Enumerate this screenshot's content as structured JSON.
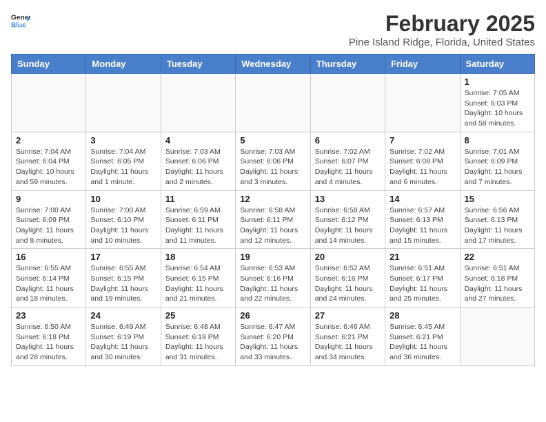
{
  "logo": {
    "general": "General",
    "blue": "Blue"
  },
  "header": {
    "title": "February 2025",
    "subtitle": "Pine Island Ridge, Florida, United States"
  },
  "weekdays": [
    "Sunday",
    "Monday",
    "Tuesday",
    "Wednesday",
    "Thursday",
    "Friday",
    "Saturday"
  ],
  "weeks": [
    [
      {
        "day": "",
        "info": ""
      },
      {
        "day": "",
        "info": ""
      },
      {
        "day": "",
        "info": ""
      },
      {
        "day": "",
        "info": ""
      },
      {
        "day": "",
        "info": ""
      },
      {
        "day": "",
        "info": ""
      },
      {
        "day": "1",
        "info": "Sunrise: 7:05 AM\nSunset: 6:03 PM\nDaylight: 10 hours and 58 minutes."
      }
    ],
    [
      {
        "day": "2",
        "info": "Sunrise: 7:04 AM\nSunset: 6:04 PM\nDaylight: 10 hours and 59 minutes."
      },
      {
        "day": "3",
        "info": "Sunrise: 7:04 AM\nSunset: 6:05 PM\nDaylight: 11 hours and 1 minute."
      },
      {
        "day": "4",
        "info": "Sunrise: 7:03 AM\nSunset: 6:06 PM\nDaylight: 11 hours and 2 minutes."
      },
      {
        "day": "5",
        "info": "Sunrise: 7:03 AM\nSunset: 6:06 PM\nDaylight: 11 hours and 3 minutes."
      },
      {
        "day": "6",
        "info": "Sunrise: 7:02 AM\nSunset: 6:07 PM\nDaylight: 11 hours and 4 minutes."
      },
      {
        "day": "7",
        "info": "Sunrise: 7:02 AM\nSunset: 6:08 PM\nDaylight: 11 hours and 6 minutes."
      },
      {
        "day": "8",
        "info": "Sunrise: 7:01 AM\nSunset: 6:09 PM\nDaylight: 11 hours and 7 minutes."
      }
    ],
    [
      {
        "day": "9",
        "info": "Sunrise: 7:00 AM\nSunset: 6:09 PM\nDaylight: 11 hours and 8 minutes."
      },
      {
        "day": "10",
        "info": "Sunrise: 7:00 AM\nSunset: 6:10 PM\nDaylight: 11 hours and 10 minutes."
      },
      {
        "day": "11",
        "info": "Sunrise: 6:59 AM\nSunset: 6:11 PM\nDaylight: 11 hours and 11 minutes."
      },
      {
        "day": "12",
        "info": "Sunrise: 6:58 AM\nSunset: 6:11 PM\nDaylight: 11 hours and 12 minutes."
      },
      {
        "day": "13",
        "info": "Sunrise: 6:58 AM\nSunset: 6:12 PM\nDaylight: 11 hours and 14 minutes."
      },
      {
        "day": "14",
        "info": "Sunrise: 6:57 AM\nSunset: 6:13 PM\nDaylight: 11 hours and 15 minutes."
      },
      {
        "day": "15",
        "info": "Sunrise: 6:56 AM\nSunset: 6:13 PM\nDaylight: 11 hours and 17 minutes."
      }
    ],
    [
      {
        "day": "16",
        "info": "Sunrise: 6:55 AM\nSunset: 6:14 PM\nDaylight: 11 hours and 18 minutes."
      },
      {
        "day": "17",
        "info": "Sunrise: 6:55 AM\nSunset: 6:15 PM\nDaylight: 11 hours and 19 minutes."
      },
      {
        "day": "18",
        "info": "Sunrise: 6:54 AM\nSunset: 6:15 PM\nDaylight: 11 hours and 21 minutes."
      },
      {
        "day": "19",
        "info": "Sunrise: 6:53 AM\nSunset: 6:16 PM\nDaylight: 11 hours and 22 minutes."
      },
      {
        "day": "20",
        "info": "Sunrise: 6:52 AM\nSunset: 6:16 PM\nDaylight: 11 hours and 24 minutes."
      },
      {
        "day": "21",
        "info": "Sunrise: 6:51 AM\nSunset: 6:17 PM\nDaylight: 11 hours and 25 minutes."
      },
      {
        "day": "22",
        "info": "Sunrise: 6:51 AM\nSunset: 6:18 PM\nDaylight: 11 hours and 27 minutes."
      }
    ],
    [
      {
        "day": "23",
        "info": "Sunrise: 6:50 AM\nSunset: 6:18 PM\nDaylight: 11 hours and 28 minutes."
      },
      {
        "day": "24",
        "info": "Sunrise: 6:49 AM\nSunset: 6:19 PM\nDaylight: 11 hours and 30 minutes."
      },
      {
        "day": "25",
        "info": "Sunrise: 6:48 AM\nSunset: 6:19 PM\nDaylight: 11 hours and 31 minutes."
      },
      {
        "day": "26",
        "info": "Sunrise: 6:47 AM\nSunset: 6:20 PM\nDaylight: 11 hours and 33 minutes."
      },
      {
        "day": "27",
        "info": "Sunrise: 6:46 AM\nSunset: 6:21 PM\nDaylight: 11 hours and 34 minutes."
      },
      {
        "day": "28",
        "info": "Sunrise: 6:45 AM\nSunset: 6:21 PM\nDaylight: 11 hours and 36 minutes."
      },
      {
        "day": "",
        "info": ""
      }
    ]
  ]
}
